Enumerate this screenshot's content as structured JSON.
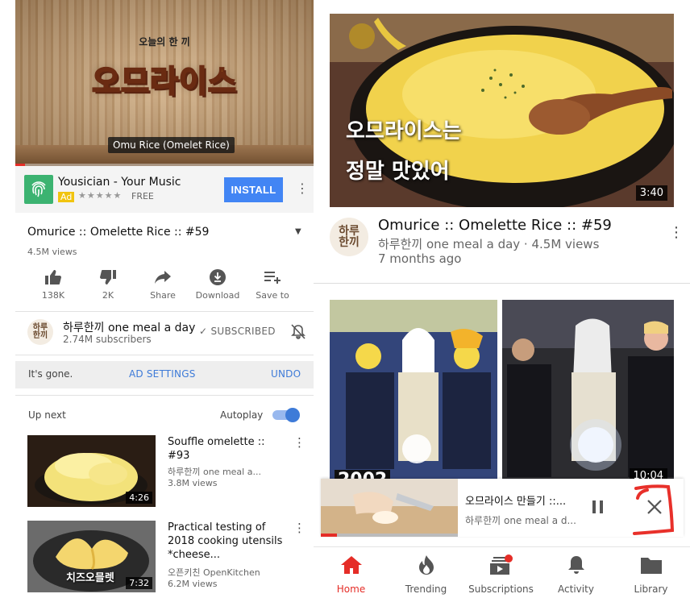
{
  "left": {
    "player": {
      "small_title": "오늘의 한 끼",
      "big_title": "오므라이스",
      "caption": "Omu Rice (Omelet Rice)"
    },
    "ad": {
      "title": "Yousician - Your Music",
      "badge": "Ad",
      "stars": "★★★★★",
      "price": "FREE",
      "install_label": "INSTALL"
    },
    "video": {
      "title": "Omurice :: Omelette Rice :: #59",
      "views": "4.5M views",
      "actions": {
        "like": "138K",
        "dislike": "2K",
        "share": "Share",
        "download": "Download",
        "save": "Save to"
      }
    },
    "channel": {
      "avatar_text": "하루\n한끼",
      "name": "하루한끼 one meal a day",
      "subs": "2.74M subscribers",
      "subscribed_label": "SUBSCRIBED"
    },
    "gone_bar": {
      "text": "It's gone.",
      "ad_settings": "AD SETTINGS",
      "undo": "UNDO"
    },
    "upnext": {
      "label": "Up next",
      "autoplay": "Autoplay",
      "items": [
        {
          "title": "Souffle omelette :: #93",
          "channel": "하루한끼 one meal a...",
          "views": "3.8M views",
          "duration": "4:26"
        },
        {
          "title": "Practical testing of 2018 cooking utensils *cheese...",
          "channel": "오픈키친 OpenKitchen",
          "views": "6.2M views",
          "duration": "7:32",
          "overlay": "치즈오믈렛"
        }
      ]
    }
  },
  "right": {
    "feed1": {
      "overlay_line1": "오므라이스는",
      "overlay_line2": "정말 맛있어",
      "duration": "3:40",
      "avatar_text": "하루\n한끼",
      "title": "Omurice :: Omelette Rice :: #59",
      "meta1": "하루한끼 one meal a day · 4.5M views",
      "meta2": "7 months ago"
    },
    "feed2": {
      "year_left": "2002",
      "duration": "10:04"
    },
    "miniplayer": {
      "title": "오므라이스 만들기 ::...",
      "subtitle": "하루한끼 one meal a d..."
    },
    "nav": [
      {
        "label": "Home",
        "icon": "home-icon"
      },
      {
        "label": "Trending",
        "icon": "flame-icon"
      },
      {
        "label": "Subscriptions",
        "icon": "subscriptions-icon"
      },
      {
        "label": "Activity",
        "icon": "bell-icon"
      },
      {
        "label": "Library",
        "icon": "folder-icon"
      }
    ]
  },
  "colors": {
    "accent_red": "#e52d27",
    "install_blue": "#4285f4",
    "link_blue": "#3e7bd8"
  }
}
